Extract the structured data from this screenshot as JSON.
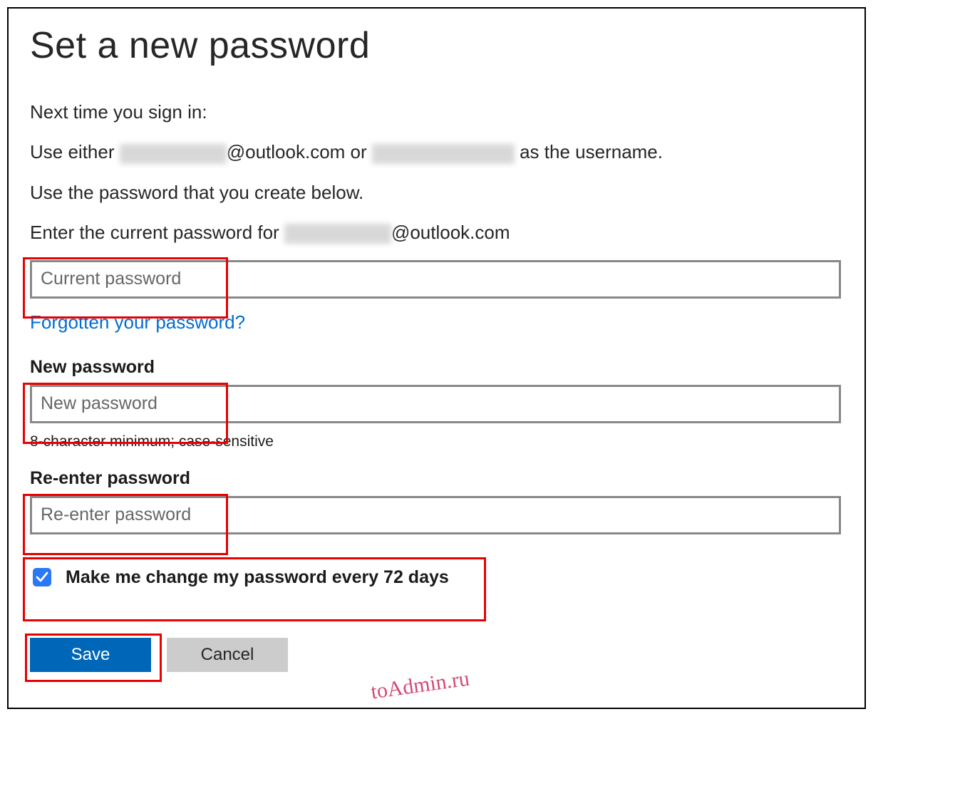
{
  "page": {
    "title": "Set a new password"
  },
  "instructions": {
    "line1": "Next time you sign in:",
    "use_either_prefix": "Use either ",
    "outlook_suffix": "@outlook.com or ",
    "as_username": " as the username.",
    "line3": "Use the password that you create below.",
    "enter_current_prefix": "Enter the current password for ",
    "outlook_domain": "@outlook.com"
  },
  "fields": {
    "current_password_placeholder": "Current password",
    "forgot_link": "Forgotten your password?",
    "new_password_label": "New password",
    "new_password_placeholder": "New password",
    "password_hint": "8-character minimum; case-sensitive",
    "reenter_label": "Re-enter password",
    "reenter_placeholder": "Re-enter password"
  },
  "checkbox": {
    "label": "Make me change my password every 72 days",
    "checked": true
  },
  "buttons": {
    "save": "Save",
    "cancel": "Cancel"
  },
  "watermark": "toAdmin.ru"
}
